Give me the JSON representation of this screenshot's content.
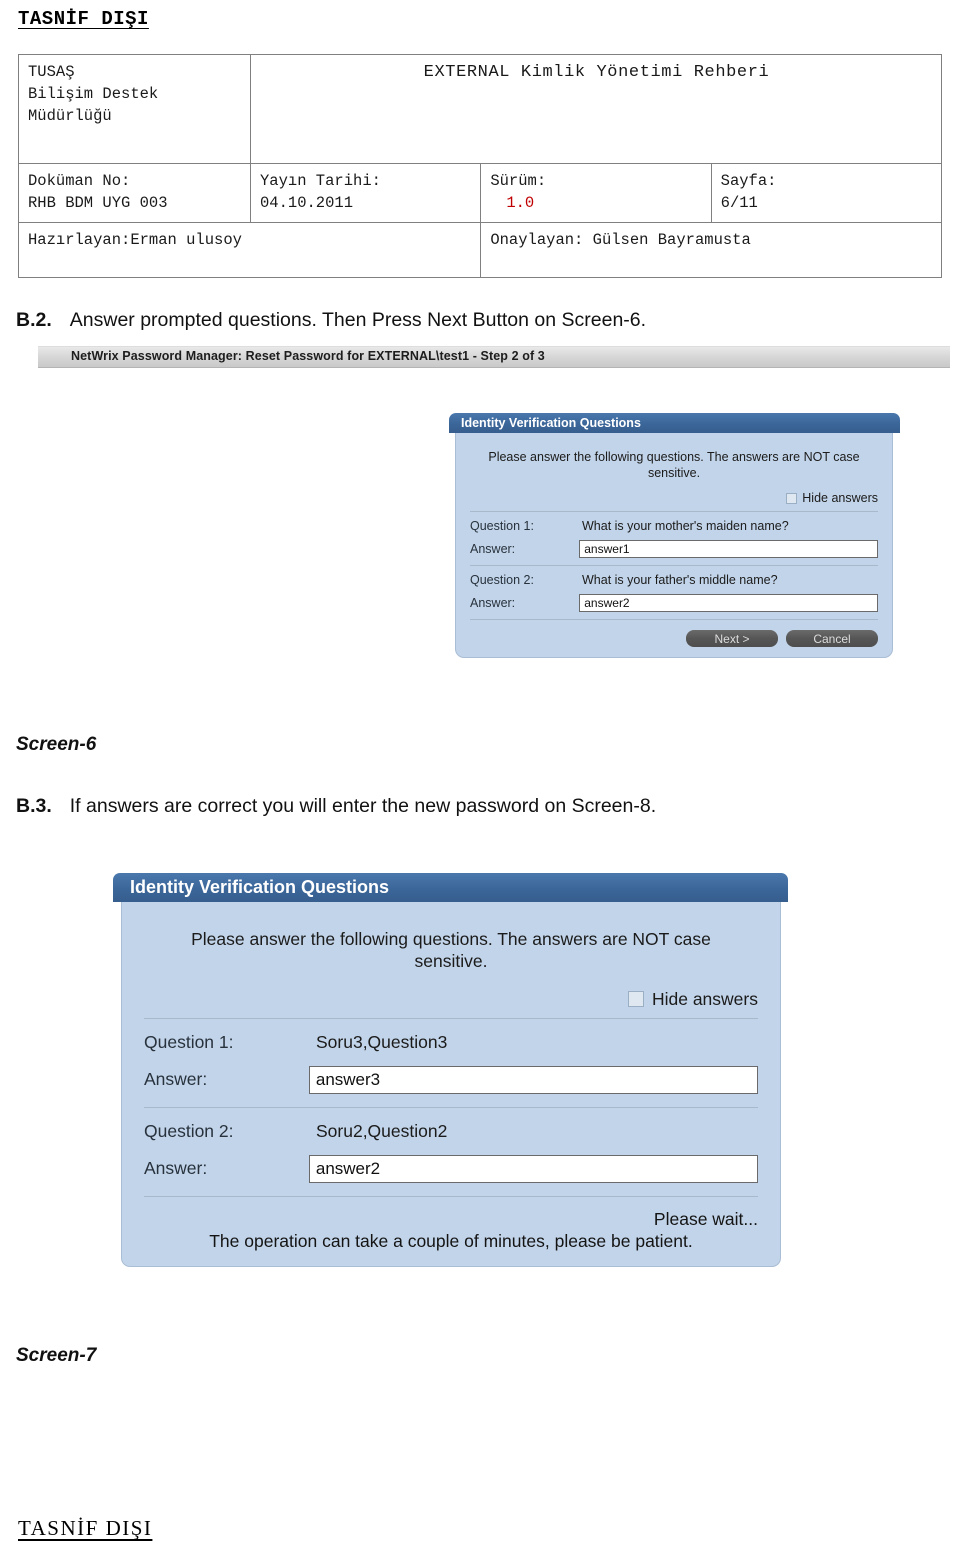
{
  "classification": {
    "top": "TASNİF DIŞI",
    "bottom": "TASNİF DIŞI"
  },
  "doc_header": {
    "organization": "TUSAŞ\nBilişim Destek\nMüdürlüğü",
    "organization_lines": [
      "TUSAŞ",
      "Bilişim Destek",
      "Müdürlüğü"
    ],
    "title": "EXTERNAL Kimlik Yönetimi Rehberi",
    "document_no_label": "Doküman No:",
    "document_no_value": "RHB BDM UYG 003",
    "issue_date_label": "Yayın Tarihi:",
    "issue_date_value": "04.10.2011",
    "version_label": "Sürüm:",
    "version_value": "1.0",
    "version_color": "#c00000",
    "page_label": "Sayfa:",
    "page_value": "6/11",
    "prepared_by": "Hazırlayan:Erman ulusoy",
    "approved_by": "Onaylayan: Gülsen Bayramusta"
  },
  "steps": {
    "b2": {
      "label": "B.2.",
      "text": "Answer prompted questions.   Then Press Next Button on Screen-6."
    },
    "b3": {
      "label": "B.3.",
      "text": "If answers are correct  you will enter the new password on Screen-8."
    }
  },
  "captions": {
    "screen_6": "Screen-6",
    "screen_7": "Screen-7"
  },
  "netwrix_strip": {
    "text": "NetWrix Password Manager: Reset Password for EXTERNAL\\test1 - Step 2 of 3"
  },
  "dialog_screen_6": {
    "title": "Identity Verification Questions",
    "intro": "Please answer the following questions. The answers are NOT case sensitive.",
    "hide_answers_label": "Hide answers",
    "question1_label": "Question 1:",
    "question1_text": "What is your mother's maiden name?",
    "answer1_label": "Answer:",
    "answer1_value": "answer1",
    "question2_label": "Question 2:",
    "question2_text": "What is your father's middle name?",
    "answer2_label": "Answer:",
    "answer2_value": "answer2",
    "next_button": "Next >",
    "cancel_button": "Cancel"
  },
  "dialog_screen_7": {
    "title": "Identity Verification Questions",
    "intro": "Please answer the following questions. The answers are NOT case sensitive.",
    "hide_answers_label": "Hide answers",
    "question1_label": "Question 1:",
    "question1_text": "Soru3,Question3",
    "answer1_label": "Answer:",
    "answer1_value": "answer3",
    "question2_label": "Question 2:",
    "question2_text": "Soru2,Question2",
    "answer2_label": "Answer:",
    "answer2_value": "answer2",
    "wait_text": "Please wait...",
    "wait_subtext": "The operation can take a couple of minutes, please be patient."
  },
  "colors": {
    "titlebar_blue": "#3b6699",
    "dialog_body_blue": "#c2d4e9",
    "button_gray": "#565656",
    "strip_gray": "#d8d8d8",
    "accent_red": "#c00000"
  }
}
